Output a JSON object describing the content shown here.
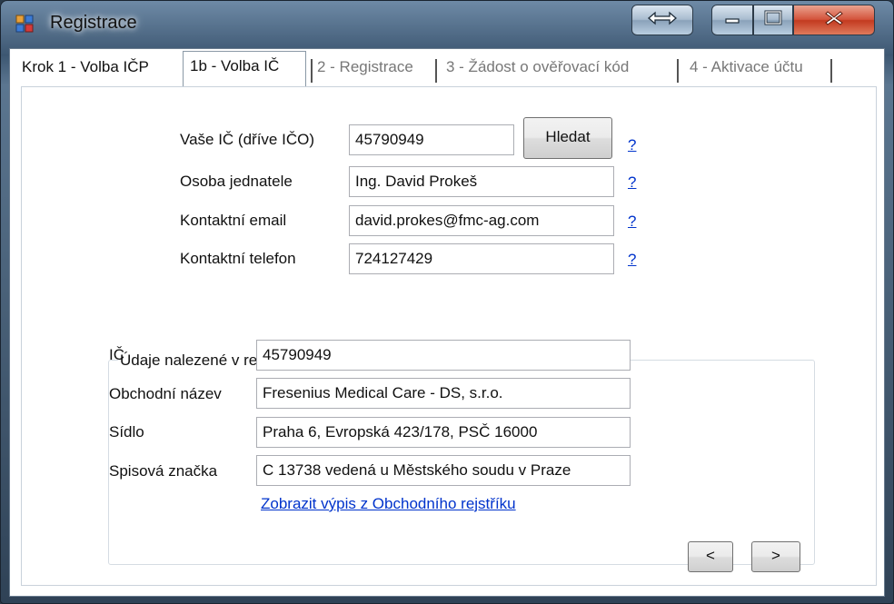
{
  "window": {
    "title": "Registrace",
    "accent_color": "#3d5772"
  },
  "tabs": [
    {
      "label": "Krok 1 - Volba IČP"
    },
    {
      "label": "1b - Volba IČ"
    },
    {
      "label": "2 - Registrace"
    },
    {
      "label": "3 -  Žádost o ověřovací kód"
    },
    {
      "label": "4 - Aktivace účtu"
    }
  ],
  "form": {
    "ic_label": "Vaše IČ (dříve IČO)",
    "ic_value": "45790949",
    "search_button": "Hledat",
    "person_label": "Osoba jednatele",
    "person_value": "Ing. David Prokeš",
    "email_label": "Kontaktní email",
    "email_value": "david.prokes@fmc-ag.com",
    "phone_label": "Kontaktní telefon",
    "phone_value": "724127429",
    "help": "?"
  },
  "registry": {
    "title": "Údaje nalezené v registrech",
    "ic_label": "IČ",
    "ic_value": "45790949",
    "name_label": "Obchodní název",
    "name_value": "Fresenius Medical Care - DS, s.r.o.",
    "seat_label": "Sídlo",
    "seat_value": "Praha 6, Evropská 423/178, PSČ 16000",
    "file_label": "Spisová značka",
    "file_value": "C 13738 vedená u Městského soudu v Praze",
    "link": "Zobrazit výpis z Obchodního rejstříku"
  },
  "nav": {
    "prev": "<",
    "next": ">"
  },
  "icons": {
    "app": "app-window-icon",
    "resize": "resize-arrows-icon",
    "minimize": "minimize-icon",
    "maximize": "maximize-icon",
    "close": "close-icon"
  }
}
